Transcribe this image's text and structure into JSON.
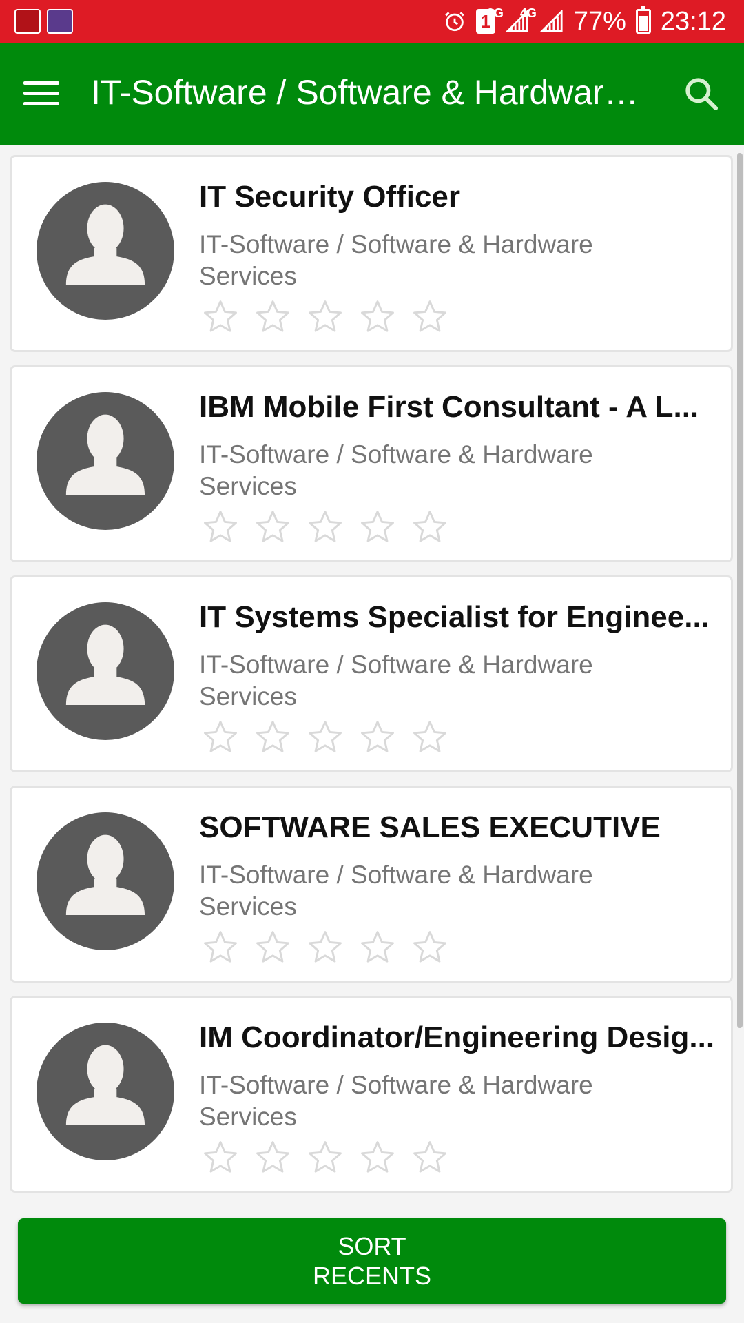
{
  "status_bar": {
    "network_4g": "4G",
    "network_3g": "3G",
    "sim_slot": "1",
    "battery": "77%",
    "time": "23:12"
  },
  "app_bar": {
    "title": "IT-Software / Software & Hardware Services"
  },
  "jobs": [
    {
      "title": "IT Security Officer",
      "category": "IT-Software / Software & Hardware Services",
      "rating": 0,
      "max_rating": 5
    },
    {
      "title": "IBM Mobile First Consultant - A L...",
      "category": "IT-Software / Software & Hardware Services",
      "rating": 0,
      "max_rating": 5
    },
    {
      "title": "IT Systems Specialist for Enginee...",
      "category": "IT-Software / Software & Hardware Services",
      "rating": 0,
      "max_rating": 5
    },
    {
      "title": "SOFTWARE SALES EXECUTIVE",
      "category": "IT-Software / Software & Hardware Services",
      "rating": 0,
      "max_rating": 5
    },
    {
      "title": "IM Coordinator/Engineering Desig...",
      "category": "IT-Software / Software & Hardware Services",
      "rating": 0,
      "max_rating": 5
    }
  ],
  "sort_button": {
    "line1": "SORT",
    "line2": "RECENTS"
  },
  "colors": {
    "status_bar": "#de1b25",
    "primary": "#008a0c",
    "avatar_bg": "#5a5a5a",
    "avatar_fg": "#f2efec",
    "star_outline": "#d9d9d9"
  }
}
